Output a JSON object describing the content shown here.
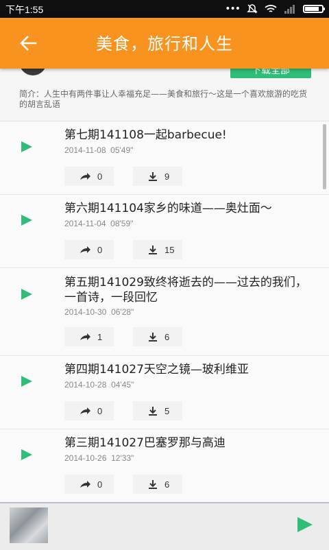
{
  "status_bar": {
    "time": "下午1:55"
  },
  "header": {
    "title": "美食，旅行和人生"
  },
  "info": {
    "download_all_label": "下载全部",
    "intro": "简介：人生中有两件事让人幸福充足——美食和旅行～这是一个喜欢旅游的吃货的胡言乱语"
  },
  "episodes": [
    {
      "title": "第七期141108一起barbecue!",
      "date": "2014-11-08",
      "duration": "05'49\"",
      "shares": "0",
      "downloads": "9"
    },
    {
      "title": "第六期141104家乡的味道——奥灶面～",
      "date": "2014-11-04",
      "duration": "08'59\"",
      "shares": "0",
      "downloads": "15"
    },
    {
      "title": "第五期141029致终将逝去的——过去的我们，一首诗，一段回忆",
      "date": "2014-10-30",
      "duration": "06'28\"",
      "shares": "1",
      "downloads": "6"
    },
    {
      "title": "第四期141027天空之镜—玻利维亚",
      "date": "2014-10-28",
      "duration": "04'45\"",
      "shares": "0",
      "downloads": "5"
    },
    {
      "title": "第三期141027巴塞罗那与高迪",
      "date": "2014-10-26",
      "duration": "12'33\"",
      "shares": "0",
      "downloads": "6"
    }
  ],
  "colors": {
    "accent": "#f7931e",
    "play": "#2fbd77"
  },
  "icons": {
    "back": "arrow-left-icon",
    "play": "play-icon",
    "share": "share-icon",
    "download": "download-icon"
  },
  "battery_level": 0.9
}
